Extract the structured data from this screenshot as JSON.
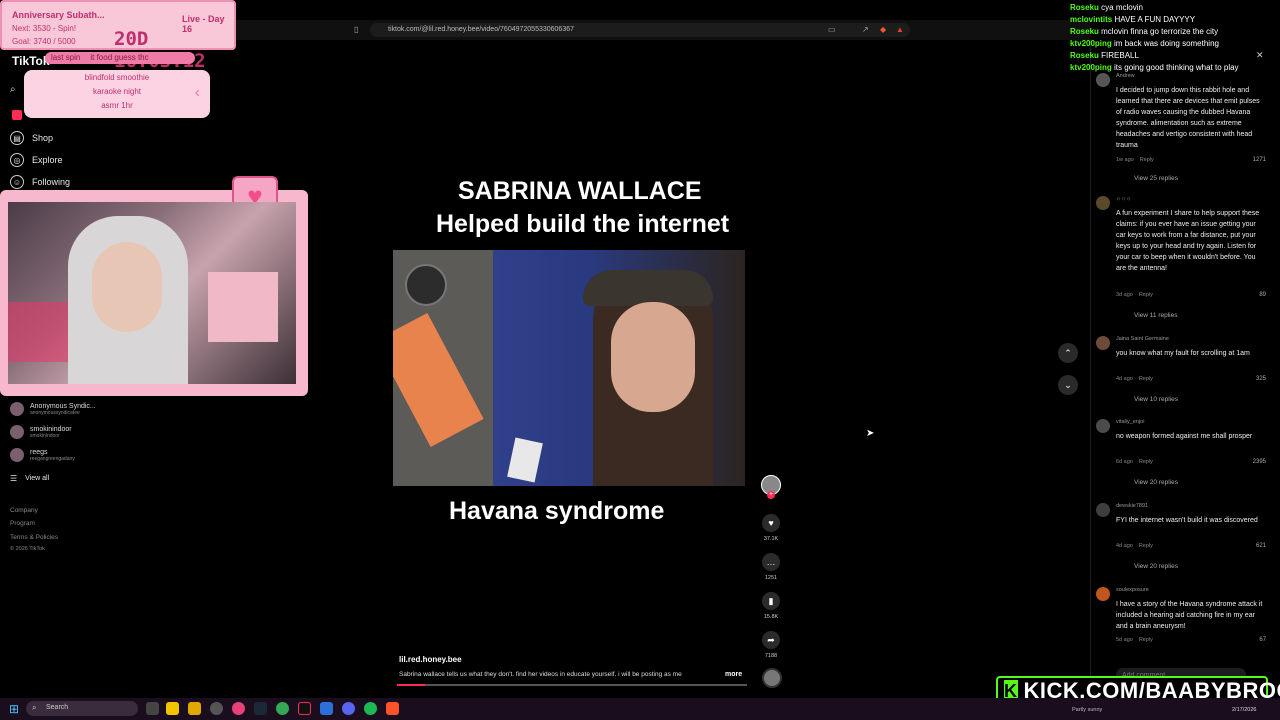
{
  "browser": {
    "url": "tiktok.com/@lil.red.honey.bee/video/7604972055330606367"
  },
  "stream": {
    "subathon_title": "Anniversary Subath...",
    "live_day": "Live - Day 16",
    "next": "Next: 3530 - Spin!",
    "goal": "Goal: 3740 / 5000",
    "timer": "20D 16:03:12",
    "last_spin_label": "last spin",
    "last_spin_value": "it food guess thc",
    "spin_options": [
      "blindfold smoothie",
      "karaoke night",
      "asmr 1hr"
    ]
  },
  "sidebar": {
    "logo": "TikTok",
    "items": [
      {
        "label": "Shop",
        "icon": "shop-icon"
      },
      {
        "label": "Explore",
        "icon": "explore-icon"
      },
      {
        "label": "Following",
        "icon": "following-icon"
      }
    ],
    "accounts": [
      {
        "name": "Anonymous Syndic...",
        "handle": "anonymoussyndicatee"
      },
      {
        "name": "smokinindoor",
        "handle": "smokinindoor"
      },
      {
        "name": "reegs",
        "handle": "reegangreengadany"
      }
    ],
    "view_all": "View all",
    "footer": [
      "Company",
      "Program",
      "Terms & Policies"
    ],
    "copyright": "© 2026 TikTok"
  },
  "video": {
    "title_line1": "SABRINA WALLACE",
    "title_line2": "Helped build the internet",
    "caption": "Havana syndrome",
    "author": "lil.red.honey.bee",
    "description": "Sabrina wallace tells us what they don't. find her videos in educate yourself. i will be posting as me",
    "more": "more",
    "likes": "37.1K",
    "comments": "1251",
    "saves": "15.8K",
    "shares": "7188"
  },
  "comments": [
    {
      "user": "Andrew",
      "text": "I decided to jump down this rabbit hole and learned that there are devices that emit pulses of radio waves causing the dubbed Havana syndrome. alimentation such as extreme headaches and vertigo consistent with head trauma",
      "time": "1w ago",
      "likes": "1271",
      "replies": "View 25 replies"
    },
    {
      "user": "☼☼☼",
      "text": "A fun experiment I share to help support these claims: if you ever have an issue getting your car keys to work from a far distance, put your keys up to your head and try again. Listen for your car to beep when it wouldn't before. You are the antenna!",
      "time": "3d ago",
      "likes": "89",
      "replies": "View 11 replies"
    },
    {
      "user": "Jaina Saint Germaine",
      "text": "you know what my fault for scrolling at 1am",
      "time": "4d ago",
      "likes": "325",
      "replies": "View 10 replies"
    },
    {
      "user": "vitaliy_enjoi",
      "text": "no weapon formed against me shall prosper",
      "time": "6d ago",
      "likes": "2395",
      "replies": "View 20 replies"
    },
    {
      "user": "dewskie7891",
      "text": "FYI the internet wasn't build it was discovered",
      "time": "4d ago",
      "likes": "621",
      "replies": "View 20 replies"
    },
    {
      "user": "soulexposure",
      "text": "I have a story of the Havana syndrome attack it included a hearing aid catching fire in my ear and a brain aneurysm!",
      "time": "5d ago",
      "likes": "67",
      "replies": ""
    }
  ],
  "comment_reply_label": "Reply",
  "comment_input_placeholder": "Add comment...",
  "chat": [
    {
      "user": "Roseku",
      "msg": "cya mclovin"
    },
    {
      "user": "mclovintits",
      "msg": "HAVE A FUN DAYYYY"
    },
    {
      "user": "Roseku",
      "msg": "mclovin finna go terrorize the city"
    },
    {
      "user": "ktv200ping",
      "msg": "im back was doing something"
    },
    {
      "user": "Roseku",
      "msg": "FIREBALL"
    },
    {
      "user": "ktv200ping",
      "msg": "its going good thinking what to play"
    }
  ],
  "kick_banner": "KICK.COM/BAABYBROOK",
  "taskbar": {
    "search": "Search",
    "weather": "Partly sunny",
    "date": "2/17/2026"
  },
  "colors": {
    "kick_green": "#53fc18",
    "overlay_pink": "#f8c8d8",
    "like_red": "#fe2c55"
  }
}
